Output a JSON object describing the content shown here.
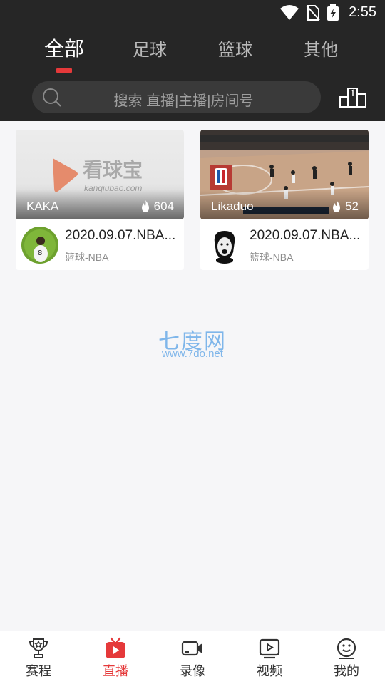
{
  "status_bar": {
    "time": "2:55"
  },
  "tabs": [
    {
      "label": "全部",
      "active": true
    },
    {
      "label": "足球",
      "active": false
    },
    {
      "label": "篮球",
      "active": false
    },
    {
      "label": "其他",
      "active": false
    }
  ],
  "search": {
    "placeholder": "搜索 直播|主播|房间号"
  },
  "cards": [
    {
      "thumbnail_brand": "看球宝",
      "thumbnail_domain": "kanqiubao.com",
      "streamer": "KAKA",
      "heat": "604",
      "title": "2020.09.07.NBA...",
      "category": "篮球-NBA"
    },
    {
      "streamer": "Likaduo",
      "heat": "52",
      "title": "2020.09.07.NBA...",
      "category": "篮球-NBA"
    }
  ],
  "watermark": {
    "name": "七度网",
    "url": "www.7do.net"
  },
  "bottom_nav": [
    {
      "label": "赛程",
      "icon": "trophy-icon",
      "active": false
    },
    {
      "label": "直播",
      "icon": "tv-icon",
      "active": true
    },
    {
      "label": "录像",
      "icon": "video-camera-icon",
      "active": false
    },
    {
      "label": "视频",
      "icon": "play-video-icon",
      "active": false
    },
    {
      "label": "我的",
      "icon": "smiley-face-icon",
      "active": false
    }
  ],
  "colors": {
    "accent": "#e5393a",
    "header_bg": "#262626",
    "page_bg": "#f6f6f8"
  }
}
